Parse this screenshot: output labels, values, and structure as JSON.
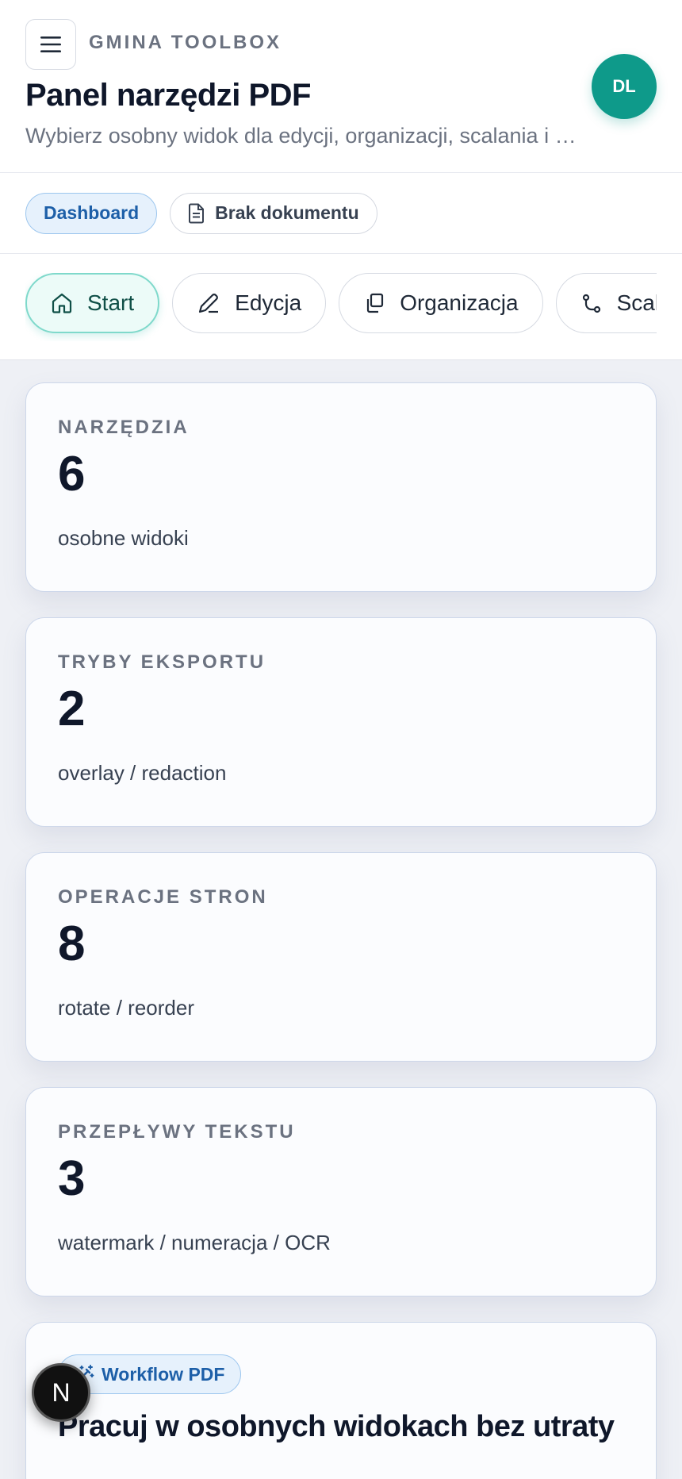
{
  "header": {
    "brand": "GMINA TOOLBOX",
    "title": "Panel narzędzi PDF",
    "subtitle": "Wybierz osobny widok dla edycji, organizacji, scalania i podpisu",
    "avatar_initials": "DL",
    "menu_icon": "hamburger-icon"
  },
  "chips": {
    "dashboard": "Dashboard",
    "document": "Brak dokumentu"
  },
  "nav": {
    "tabs": [
      {
        "label": "Start",
        "icon": "home-icon",
        "active": true
      },
      {
        "label": "Edycja",
        "icon": "pencil-icon",
        "active": false
      },
      {
        "label": "Organizacja",
        "icon": "copy-pages-icon",
        "active": false
      },
      {
        "label": "Scalanie",
        "icon": "route-icon",
        "active": false
      }
    ]
  },
  "stats": [
    {
      "label": "NARZĘDZIA",
      "value": "6",
      "desc": "osobne widoki"
    },
    {
      "label": "TRYBY EKSPORTU",
      "value": "2",
      "desc": "overlay / redaction"
    },
    {
      "label": "OPERACJE STRON",
      "value": "8",
      "desc": "rotate / reorder"
    },
    {
      "label": "PRZEPŁYWY TEKSTU",
      "value": "3",
      "desc": "watermark / numeracja / OCR"
    }
  ],
  "workflow": {
    "badge": "Workflow PDF",
    "title": "Pracuj w osobnych widokach bez utraty"
  },
  "fab": {
    "letter": "N"
  },
  "colors": {
    "accent": "#0e9a8a",
    "chip_blue": "#1d5fa8",
    "background": "#eef0f5"
  }
}
